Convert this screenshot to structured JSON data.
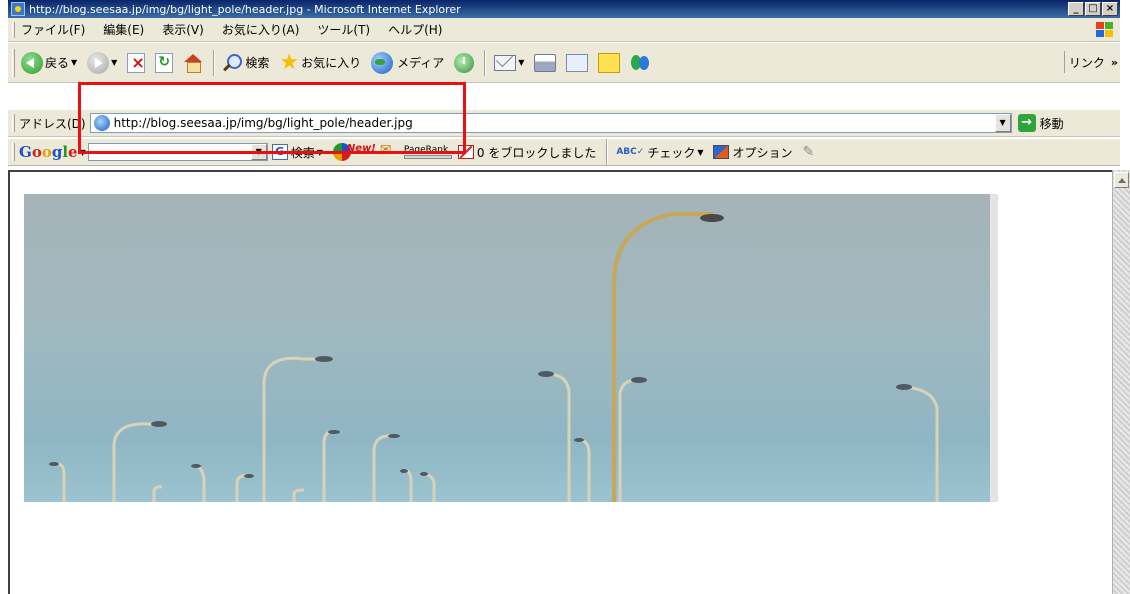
{
  "window": {
    "title": "http://blog.seesaa.jp/img/bg/light_pole/header.jpg - Microsoft Internet Explorer",
    "buttons": [
      "_",
      "□",
      "×"
    ]
  },
  "menu": {
    "items": [
      "ファイル(F)",
      "編集(E)",
      "表示(V)",
      "お気に入り(A)",
      "ツール(T)",
      "ヘルプ(H)"
    ]
  },
  "toolbar": {
    "back_label": "戻る",
    "search_label": "検索",
    "favorites_label": "お気に入り",
    "media_label": "メディア",
    "links_label": "リンク",
    "links_chevron": "»"
  },
  "address": {
    "label": "アドレス(D)",
    "url": "http://blog.seesaa.jp/img/bg/light_pole/header.jpg",
    "go_label": "移動"
  },
  "google": {
    "logo": [
      "G",
      "o",
      "o",
      "g",
      "l",
      "e"
    ],
    "query": "",
    "search_label": "検索",
    "new_label": "New!",
    "pagerank_label": "PageRank",
    "popup_blocked_label": "0 をブロックしました",
    "check_label": "チェック",
    "options_label": "オプション"
  },
  "colors": {
    "highlight": "#e81010",
    "titlebar": "#0a246a",
    "toolbar_bg": "#ece9d8"
  }
}
